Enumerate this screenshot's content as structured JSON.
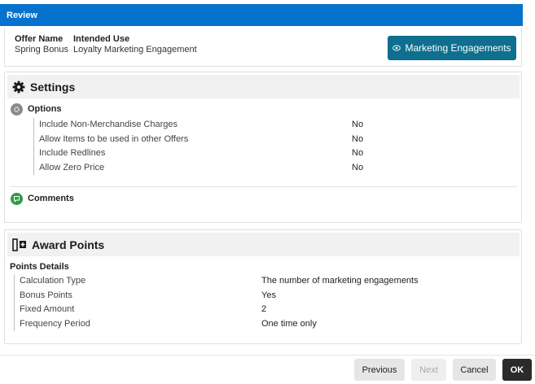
{
  "header": {
    "title": "Review"
  },
  "offer": {
    "name_label": "Offer Name",
    "name_value": "Spring Bonus",
    "use_label": "Intended Use",
    "use_value": "Loyalty Marketing Engagement",
    "engagements_button": "Marketing Engagements"
  },
  "settings": {
    "title": "Settings",
    "options_label": "Options",
    "options": [
      {
        "label": "Include Non-Merchandise Charges",
        "value": "No"
      },
      {
        "label": "Allow Items to be used in other Offers",
        "value": "No"
      },
      {
        "label": "Include Redlines",
        "value": "No"
      },
      {
        "label": "Allow Zero Price",
        "value": "No"
      }
    ],
    "comments_label": "Comments"
  },
  "award": {
    "title": "Award Points",
    "details_label": "Points Details",
    "details": [
      {
        "label": "Calculation Type",
        "value": "The number of marketing engagements"
      },
      {
        "label": "Bonus Points",
        "value": "Yes"
      },
      {
        "label": "Fixed Amount",
        "value": "2"
      },
      {
        "label": "Frequency Period",
        "value": "One time only"
      }
    ]
  },
  "footer": {
    "previous": "Previous",
    "next": "Next",
    "cancel": "Cancel",
    "ok": "OK"
  },
  "colors": {
    "header": "#0572ce",
    "engagements_button": "#0e6f8e",
    "options_icon": "#8a8a8a",
    "comments_icon": "#2e9b46",
    "ok_button": "#2b2b2b"
  }
}
